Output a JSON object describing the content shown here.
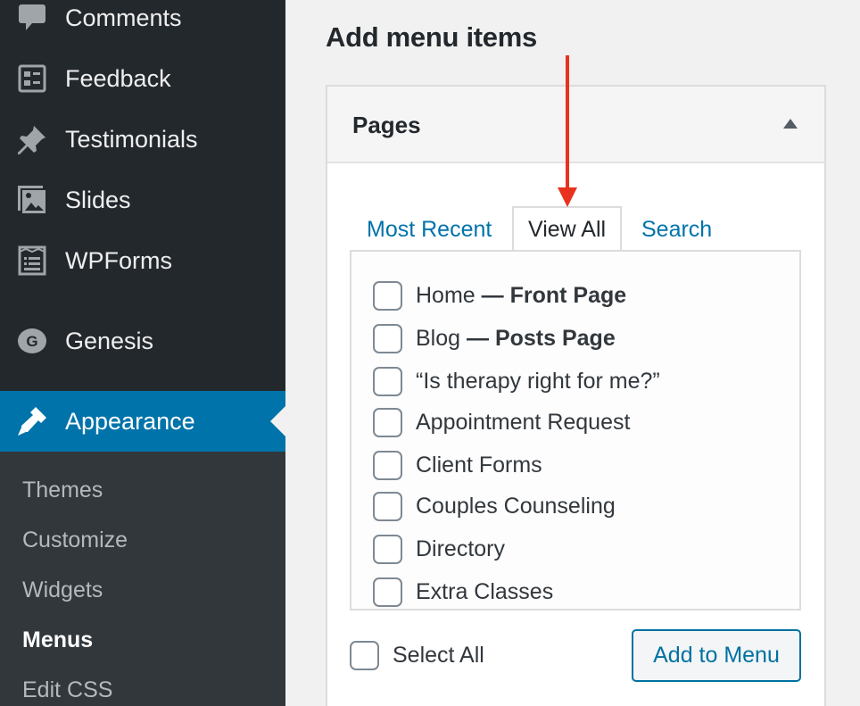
{
  "sidebar": {
    "items": [
      {
        "label": "Comments",
        "icon": "comment-icon"
      },
      {
        "label": "Feedback",
        "icon": "feedback-icon"
      },
      {
        "label": "Testimonials",
        "icon": "pin-icon"
      },
      {
        "label": "Slides",
        "icon": "slides-icon"
      },
      {
        "label": "WPForms",
        "icon": "wpforms-icon"
      },
      {
        "label": "Genesis",
        "icon": "genesis-icon"
      },
      {
        "label": "Appearance",
        "icon": "brush-icon",
        "active": true
      }
    ],
    "submenu": [
      "Themes",
      "Customize",
      "Widgets",
      "Menus",
      "Edit CSS"
    ],
    "current_submenu": "Menus"
  },
  "main": {
    "heading": "Add menu items",
    "panel": {
      "title": "Pages",
      "tabs": [
        "Most Recent",
        "View All",
        "Search"
      ],
      "active_tab": "View All",
      "pages": [
        {
          "label": "Home",
          "suffix": "Front Page"
        },
        {
          "label": "Blog",
          "suffix": "Posts Page"
        },
        {
          "label": "“Is therapy right for me?”",
          "suffix": ""
        },
        {
          "label": "Appointment Request",
          "suffix": ""
        },
        {
          "label": "Client Forms",
          "suffix": ""
        },
        {
          "label": "Couples Counseling",
          "suffix": ""
        },
        {
          "label": "Directory",
          "suffix": ""
        },
        {
          "label": "Extra Classes",
          "suffix": ""
        }
      ],
      "dash": "—",
      "select_all": "Select All",
      "add_button": "Add to Menu"
    }
  },
  "colors": {
    "sidebar_bg": "#23282d",
    "submenu_bg": "#32373c",
    "accent": "#0073aa",
    "annotation_arrow": "#e8321f"
  }
}
